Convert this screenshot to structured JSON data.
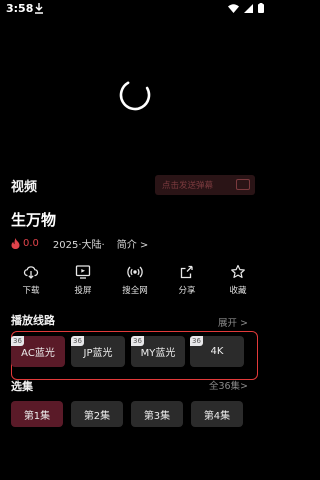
{
  "status": {
    "time": "3:58"
  },
  "detail": {
    "video_label": "视频",
    "danmaku_placeholder": "点击发送弹幕",
    "title": "生万物",
    "rating": "0.0",
    "meta": "2025·大陆·",
    "intro_label": "简介 >"
  },
  "actions": [
    {
      "label": "下载",
      "icon": "download-icon"
    },
    {
      "label": "投屏",
      "icon": "cast-icon"
    },
    {
      "label": "搜全网",
      "icon": "broadcast-icon"
    },
    {
      "label": "分享",
      "icon": "share-icon"
    },
    {
      "label": "收藏",
      "icon": "star-icon"
    }
  ],
  "routes": {
    "title": "播放线路",
    "more": "展开 >",
    "items": [
      {
        "label": "AC蓝光",
        "badge": "36"
      },
      {
        "label": "JP蓝光",
        "badge": "36"
      },
      {
        "label": "MY蓝光",
        "badge": "36"
      },
      {
        "label": "4K",
        "badge": "36"
      }
    ]
  },
  "episodes": {
    "title": "选集",
    "more": "全36集>",
    "items": [
      {
        "label": "第1集"
      },
      {
        "label": "第2集"
      },
      {
        "label": "第3集"
      },
      {
        "label": "第4集"
      }
    ]
  },
  "colors": {
    "accent": "#e0434b",
    "highlight_border": "#e23a3a",
    "active_chip": "#5a1a28",
    "chip": "#2b2b2b"
  }
}
